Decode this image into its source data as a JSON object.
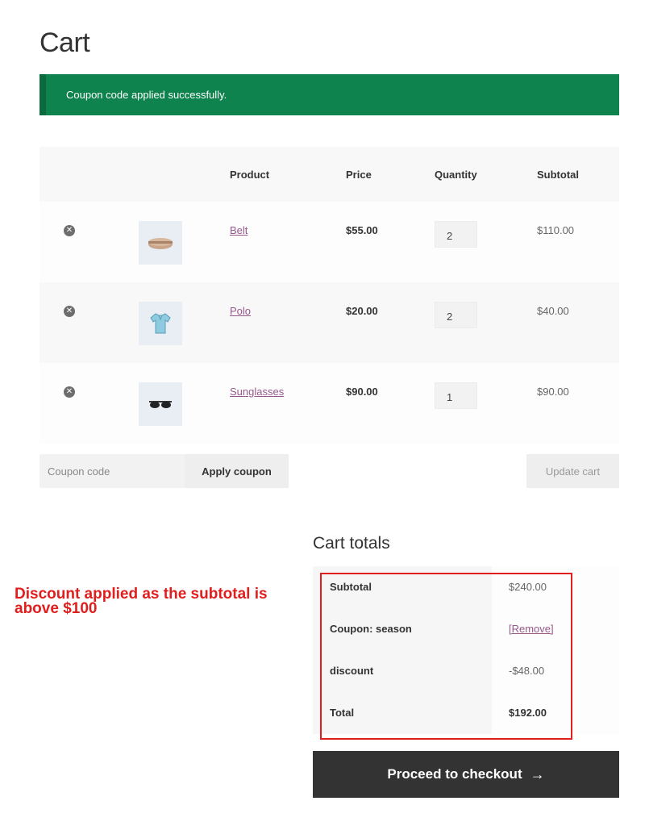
{
  "page": {
    "title": "Cart"
  },
  "notice": {
    "text": "Coupon code applied successfully.",
    "color": "#0f834d"
  },
  "table": {
    "headers": {
      "product": "Product",
      "price": "Price",
      "quantity": "Quantity",
      "subtotal": "Subtotal"
    },
    "items": [
      {
        "name": "Belt",
        "price": "$55.00",
        "quantity": "2",
        "subtotal": "$110.00",
        "icon": "belt-icon"
      },
      {
        "name": "Polo",
        "price": "$20.00",
        "quantity": "2",
        "subtotal": "$40.00",
        "icon": "polo-shirt-icon"
      },
      {
        "name": "Sunglasses",
        "price": "$90.00",
        "quantity": "1",
        "subtotal": "$90.00",
        "icon": "sunglasses-icon"
      }
    ]
  },
  "actions": {
    "coupon_placeholder": "Coupon code",
    "apply_label": "Apply coupon",
    "update_label": "Update cart"
  },
  "totals": {
    "title": "Cart totals",
    "subtotal_label": "Subtotal",
    "subtotal_value": "$240.00",
    "coupon_label": "Coupon: season",
    "coupon_remove": "[Remove]",
    "discount_label": "discount",
    "discount_value": "-$48.00",
    "total_label": "Total",
    "total_value": "$192.00"
  },
  "checkout": {
    "label": "Proceed to checkout",
    "arrow": "→"
  },
  "annotation": {
    "text": "Discount applied as the subtotal is above $100",
    "color": "#e01e1e"
  },
  "colors": {
    "link": "#96588a",
    "button_dark": "#333333"
  }
}
